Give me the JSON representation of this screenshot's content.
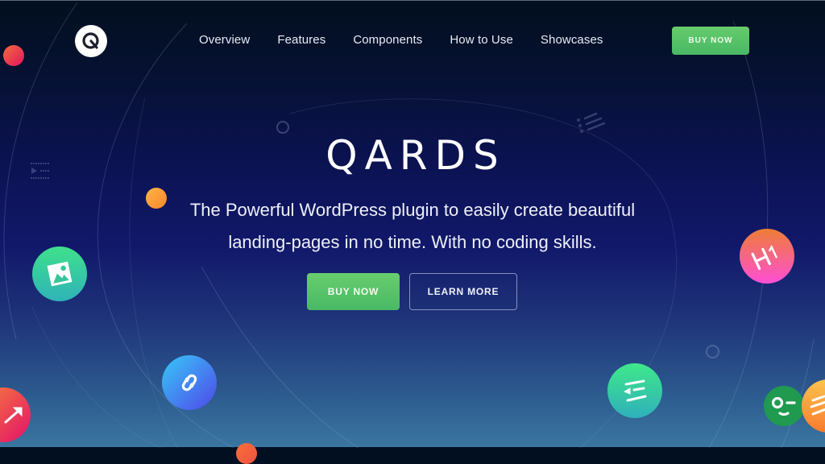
{
  "nav": {
    "logo_letter": "Q",
    "links": [
      "Overview",
      "Features",
      "Components",
      "How to Use",
      "Showcases"
    ],
    "buy_label": "BUY NOW"
  },
  "hero": {
    "title": "QARDS",
    "subtitle_line1": "The Powerful WordPress plugin to easily create beautiful",
    "subtitle_line2": "landing-pages in no time. With no coding skills.",
    "buy_label": "BUY NOW",
    "learn_label": "LEARN MORE"
  },
  "decorations": {
    "bubbles": [
      {
        "name": "image-icon",
        "colors": [
          "#3fe08c",
          "#2fb3b8"
        ]
      },
      {
        "name": "link-icon",
        "colors": [
          "#36c3f7",
          "#5046ea"
        ]
      },
      {
        "name": "expand-arrow-icon",
        "colors": [
          "#f36d3c",
          "#e3106a"
        ]
      },
      {
        "name": "heading-h1-icon",
        "colors": [
          "#ee7a3a",
          "#ff4fd0"
        ],
        "text": "H1"
      },
      {
        "name": "indent-icon",
        "colors": [
          "#3fe88a",
          "#2fb0bb"
        ]
      },
      {
        "name": "toggle-icon",
        "colors": [
          "#1f9a4f",
          "#1f9a4f"
        ]
      },
      {
        "name": "slider-lines-icon",
        "colors": [
          "#fdc34e",
          "#f87b2f"
        ]
      }
    ],
    "dots": [
      {
        "name": "red-dot",
        "colors": [
          "#f36c3c",
          "#e2155f"
        ]
      },
      {
        "name": "orange-dot",
        "colors": [
          "#ffb545",
          "#f7852e"
        ]
      },
      {
        "name": "coral-dot",
        "colors": [
          "#f8703a",
          "#f05040"
        ]
      }
    ]
  }
}
